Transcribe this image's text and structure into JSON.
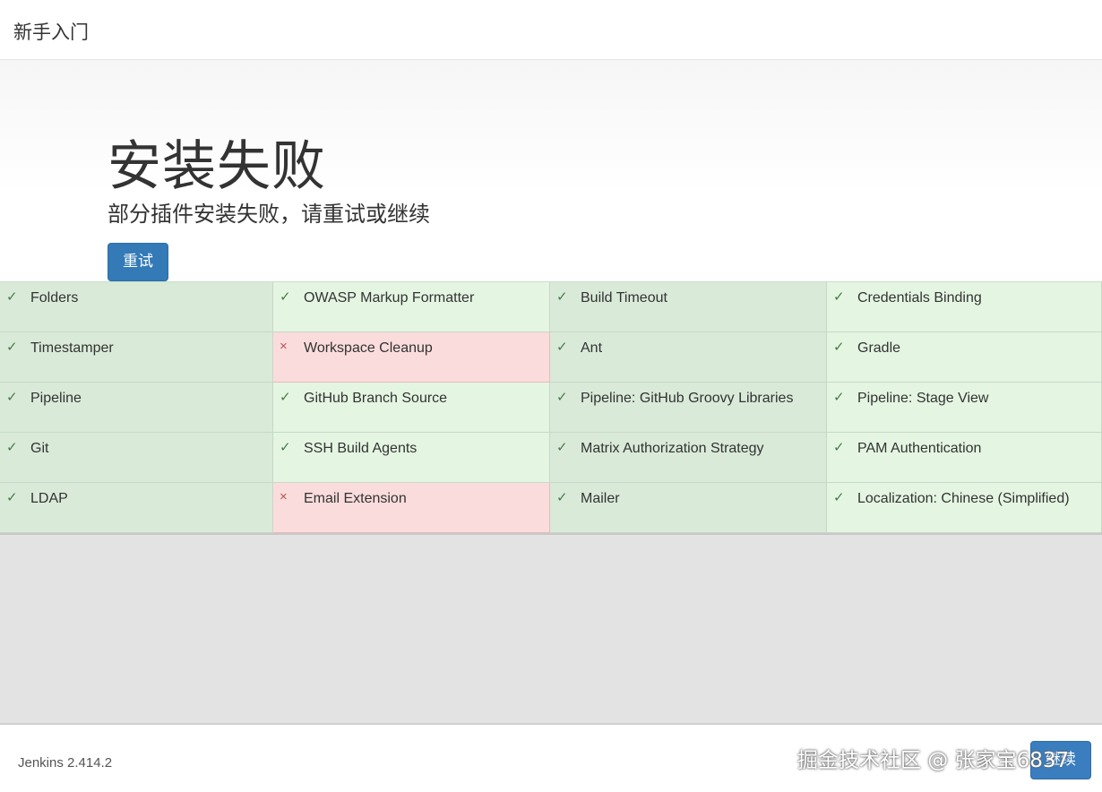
{
  "header": {
    "title": "新手入门"
  },
  "hero": {
    "title": "安装失败",
    "subtitle": "部分插件安装失败，请重试或继续",
    "retry_label": "重试"
  },
  "plugins": [
    {
      "name": "Folders",
      "status": "success"
    },
    {
      "name": "OWASP Markup Formatter",
      "status": "success"
    },
    {
      "name": "Build Timeout",
      "status": "success"
    },
    {
      "name": "Credentials Binding",
      "status": "success"
    },
    {
      "name": "Timestamper",
      "status": "success"
    },
    {
      "name": "Workspace Cleanup",
      "status": "failed"
    },
    {
      "name": "Ant",
      "status": "success"
    },
    {
      "name": "Gradle",
      "status": "success"
    },
    {
      "name": "Pipeline",
      "status": "success"
    },
    {
      "name": "GitHub Branch Source",
      "status": "success"
    },
    {
      "name": "Pipeline: GitHub Groovy Libraries",
      "status": "success"
    },
    {
      "name": "Pipeline: Stage View",
      "status": "success"
    },
    {
      "name": "Git",
      "status": "success"
    },
    {
      "name": "SSH Build Agents",
      "status": "success"
    },
    {
      "name": "Matrix Authorization Strategy",
      "status": "success"
    },
    {
      "name": "PAM Authentication",
      "status": "success"
    },
    {
      "name": "LDAP",
      "status": "success"
    },
    {
      "name": "Email Extension",
      "status": "failed"
    },
    {
      "name": "Mailer",
      "status": "success"
    },
    {
      "name": "Localization: Chinese (Simplified)",
      "status": "success"
    }
  ],
  "icons": {
    "success": "✓",
    "failed": "×"
  },
  "footer": {
    "version": "Jenkins 2.414.2",
    "continue_label": "继续",
    "watermark": "掘金技术社区 @ 张家宝6837"
  },
  "colors": {
    "primary": "#337ab7",
    "success_bg_dark": "#d9ead9",
    "success_bg_light": "#e4f6e2",
    "failed_bg": "#fbdcdc"
  }
}
